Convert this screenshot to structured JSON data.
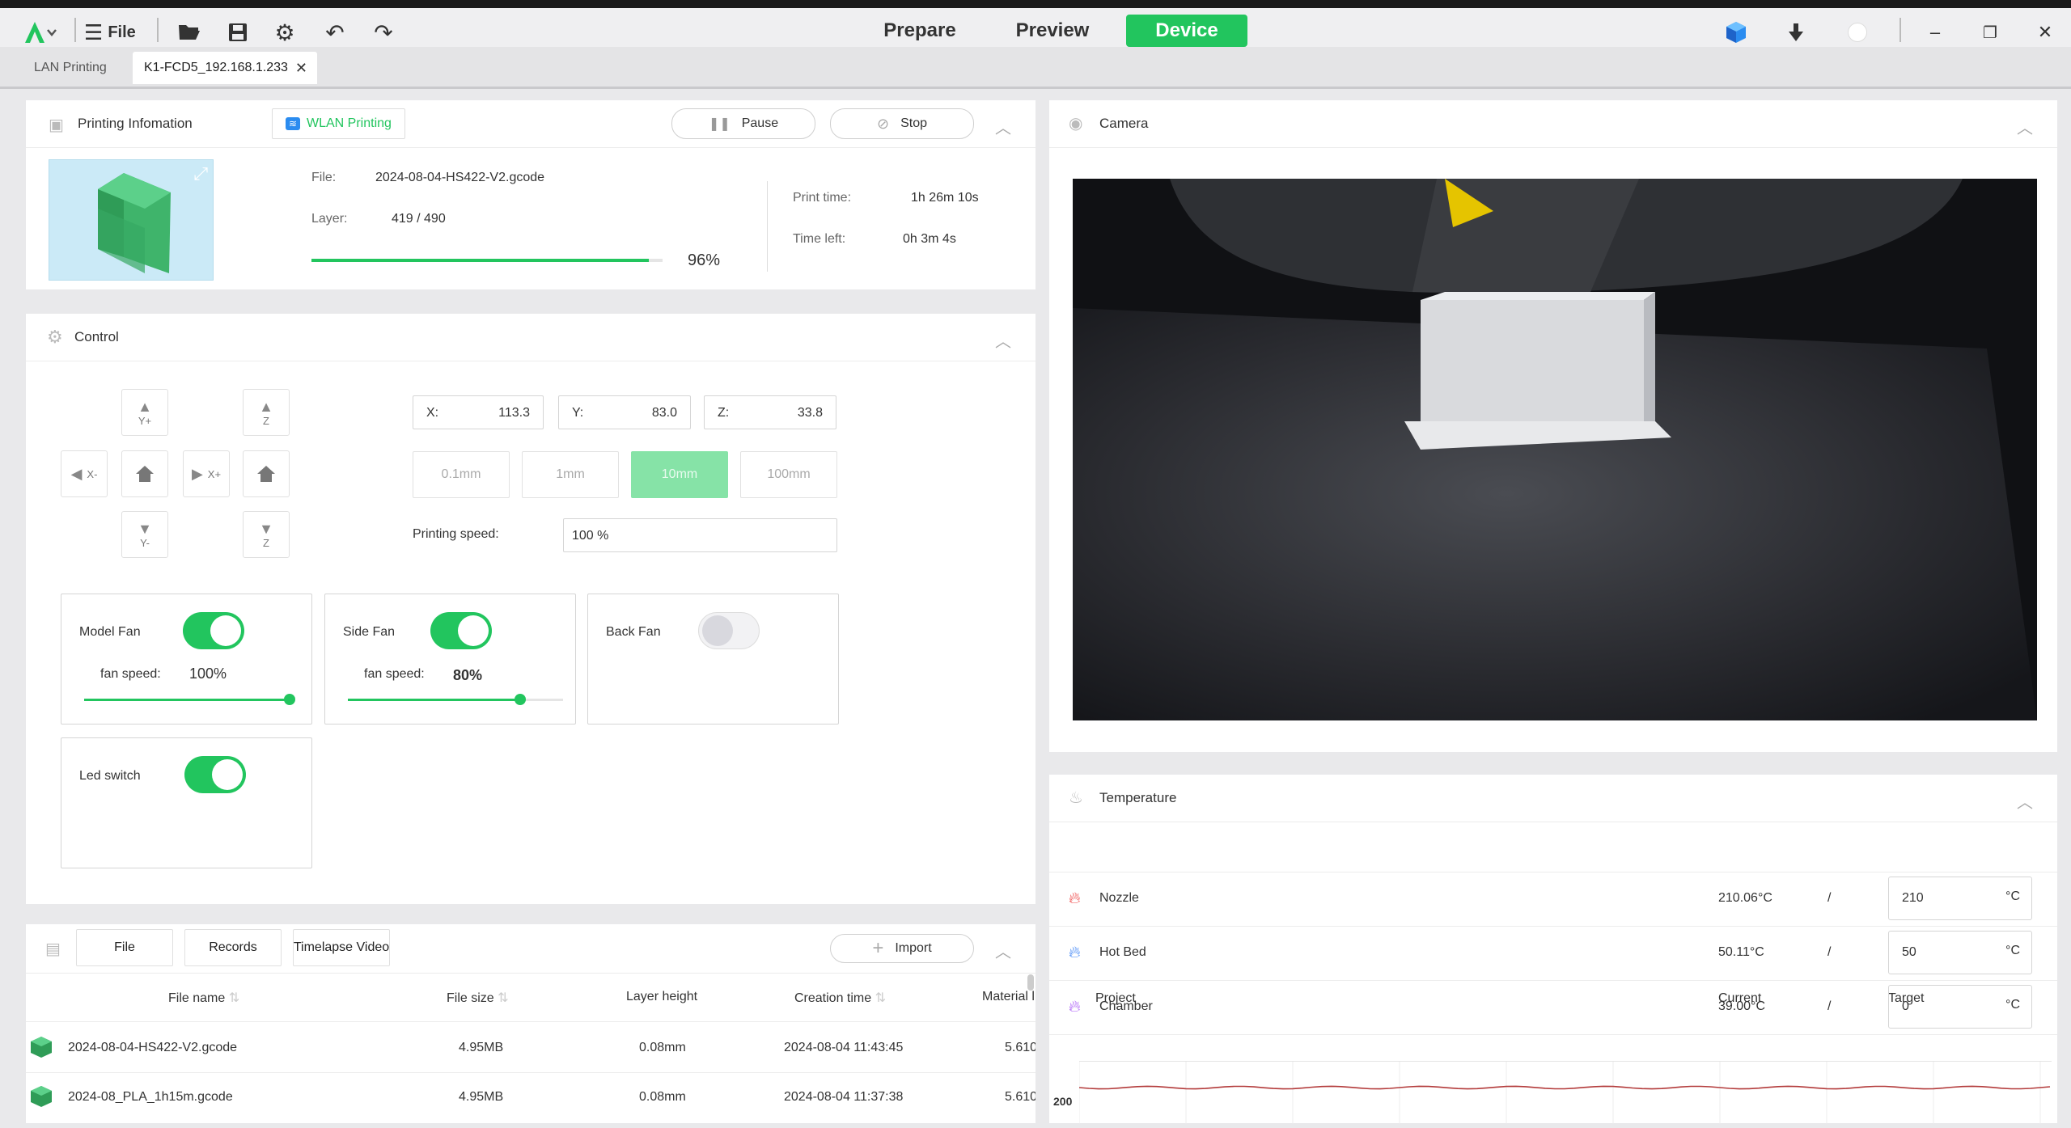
{
  "titlebar": {
    "file_label": "File",
    "tabs": [
      {
        "label": "Prepare",
        "active": false
      },
      {
        "label": "Preview",
        "active": false
      },
      {
        "label": "Device",
        "active": true
      }
    ]
  },
  "doc_tabs": [
    {
      "label": "LAN Printing",
      "active": false
    },
    {
      "label": "K1-FCD5_192.168.1.233",
      "active": true
    }
  ],
  "printing": {
    "title": "Printing Infomation",
    "mode_label": "WLAN Printing",
    "pause_label": "Pause",
    "stop_label": "Stop",
    "file_label": "File:",
    "file_value": "2024-08-04-HS422-V2.gcode",
    "layer_label": "Layer:",
    "layer_value": "419 / 490",
    "progress_percent": 96,
    "progress_text": "96%",
    "print_time_label": "Print time:",
    "print_time_value": "1h 26m 10s",
    "time_left_label": "Time left:",
    "time_left_value": "0h 3m 4s"
  },
  "control": {
    "title": "Control",
    "jog": {
      "y_plus": "Y+",
      "y_minus": "Y-",
      "x_minus": "X-",
      "x_plus": "X+",
      "z_up": "Z",
      "z_down": "Z"
    },
    "coords": {
      "x_label": "X:",
      "x_value": "113.3",
      "y_label": "Y:",
      "y_value": "83.0",
      "z_label": "Z:",
      "z_value": "33.8"
    },
    "steps": [
      {
        "label": "0.1mm",
        "active": false
      },
      {
        "label": "1mm",
        "active": false
      },
      {
        "label": "10mm",
        "active": true
      },
      {
        "label": "100mm",
        "active": false
      }
    ],
    "speed_label": "Printing speed:",
    "speed_value": "100 %",
    "model_fan": {
      "label": "Model Fan",
      "on": true,
      "speed_label": "fan speed:",
      "speed_value": "100%",
      "level": 1.0
    },
    "side_fan": {
      "label": "Side Fan",
      "on": true,
      "speed_label": "fan speed:",
      "speed_value": "80%",
      "level": 0.8
    },
    "back_fan": {
      "label": "Back Fan",
      "on": false
    },
    "led": {
      "label": "Led switch",
      "on": true
    }
  },
  "files": {
    "tabs": [
      "File",
      "Records",
      "Timelapse Video"
    ],
    "import_label": "Import",
    "columns": [
      "File name",
      "File size",
      "Layer height",
      "Creation time",
      "Material l"
    ],
    "rows": [
      {
        "name": "2024-08-04-HS422-V2.gcode",
        "size": "4.95MB",
        "layer_height": "0.08mm",
        "created": "2024-08-04 11:43:45",
        "material": "5.610"
      },
      {
        "name": "2024-08_PLA_1h15m.gcode",
        "size": "4.95MB",
        "layer_height": "0.08mm",
        "created": "2024-08-04 11:37:38",
        "material": "5.610"
      }
    ]
  },
  "camera": {
    "title": "Camera"
  },
  "temperature": {
    "title": "Temperature",
    "columns": {
      "project": "Project",
      "current": "Current",
      "target": "Target"
    },
    "rows": [
      {
        "name": "Nozzle",
        "current": "210.06°C",
        "sep": "/",
        "target": "210",
        "unit": "°C",
        "color": "#ef4444"
      },
      {
        "name": "Hot Bed",
        "current": "50.11°C",
        "sep": "/",
        "target": "50",
        "unit": "°C",
        "color": "#3b82f6"
      },
      {
        "name": "Chamber",
        "current": "39.00°C",
        "sep": "/",
        "target": "0",
        "unit": "°C",
        "color": "#a855f7"
      }
    ],
    "chart_tick": "200"
  },
  "colors": {
    "accent": "#22c55e"
  }
}
